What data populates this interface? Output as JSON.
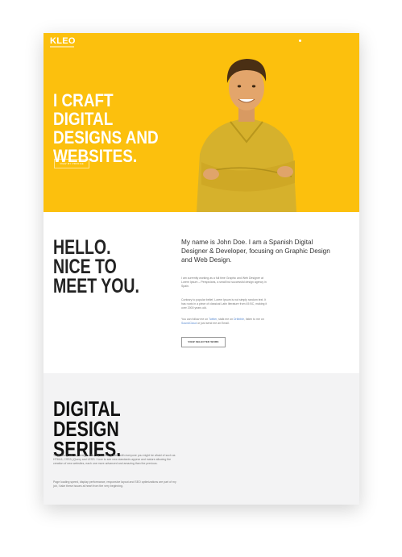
{
  "header": {
    "logo": "KLEO",
    "menu_label": "•"
  },
  "hero": {
    "title": "I CRAFT DIGITAL DESIGNS AND WEBSITES.",
    "button_label": "VIEW MY PROFILE",
    "photo_alt": "portrait"
  },
  "intro": {
    "heading": "HELLO. NICE TO MEET YOU.",
    "lead": "My name is John Doe. I am a Spanish Digital Designer & Developer, focusing on Graphic Design and Web Design.",
    "p1": "I am currently working as a full time Graphic and Web Designer at Lorem Ipsum – Perspicians, a small but successful design agency in Spain.",
    "p2": "Contrary to popular belief, Lorem Ipsum is not simply random text. It has roots in a piece of classical Latin literature from 45 BC, making it over 2000 years old.",
    "p3_pre": "You can follow me on ",
    "p3_twitter": "Twitter",
    "p3_mid1": ", stalk me on ",
    "p3_dribbble": "Dribbble",
    "p3_mid2": ", listen to me on ",
    "p3_soundcloud": "SoundCloud",
    "p3_post": " or just send me an Email.",
    "button_label": "VIEW SELECTED WORK"
  },
  "series": {
    "heading": "DIGITAL DESIGN SERIES.",
    "p1": "To go along with my design skills, my toolbox is filled with everyone you might be afraid of such as HTML5, CSS3, jQuery and LESS. I love to see new standards appear and mature allowing the creation of new websites, each one more advanced and amazing than the previous.",
    "p2": "Page loading speed, display performance, responsive layout and SEO optimizations are part of my job, I take these issues at heart from the very beginning."
  },
  "colors": {
    "accent": "#fcc00d",
    "heading": "#222222",
    "link": "#5b8bd1",
    "section_bg": "#f3f3f4"
  }
}
